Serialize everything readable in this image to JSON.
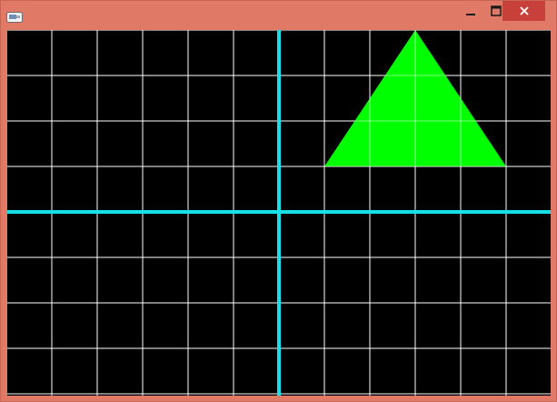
{
  "window": {
    "title": "",
    "frame_color": "#e07a66",
    "close_button_color": "#c7403a",
    "controls": {
      "minimize_icon": "minimize-icon",
      "maximize_icon": "maximize-icon",
      "close_icon": "close-icon"
    }
  },
  "canvas": {
    "background": "#000000",
    "grid_color": "#ffffff",
    "axis_color": "#18e0e8",
    "shape_color": "#00ff00",
    "grid": {
      "x_min": -6,
      "x_max": 6,
      "y_min": -4,
      "y_max": 4,
      "step": 1
    },
    "triangle": [
      [
        1,
        1
      ],
      [
        3,
        4
      ],
      [
        5,
        1
      ]
    ]
  }
}
